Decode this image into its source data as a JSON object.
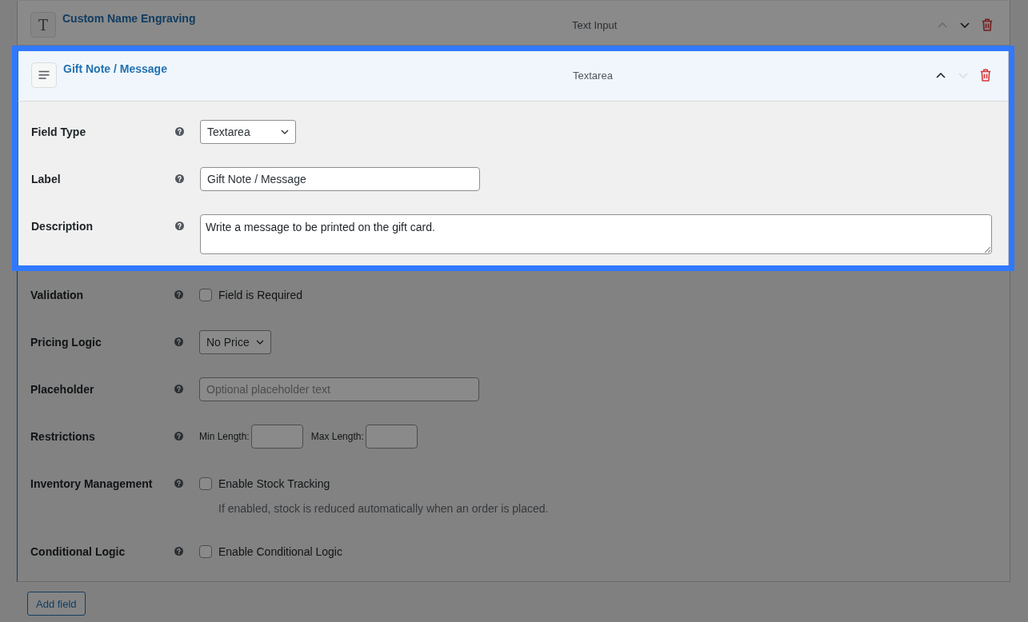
{
  "fields": [
    {
      "kind": "text",
      "icon_glyph": "T",
      "title": "Custom Name Engraving",
      "type_label": "Text Input",
      "expanded": false,
      "highlighted": false,
      "up_disabled": true,
      "down_disabled": false
    },
    {
      "kind": "textarea",
      "title": "Gift Note / Message",
      "type_label": "Textarea",
      "expanded": true,
      "highlighted": true,
      "up_disabled": false,
      "down_disabled": true,
      "settings": [
        {
          "kind": "select",
          "label": "Field Type",
          "value": "Textarea",
          "highlighted": true
        },
        {
          "kind": "text",
          "label": "Label",
          "value": "Gift Note / Message",
          "highlighted": true
        },
        {
          "kind": "textarea",
          "label": "Description",
          "value": "Write a message to be printed on the gift card.",
          "highlighted": true
        },
        {
          "kind": "checkbox",
          "label": "Validation",
          "option": "Field is Required",
          "checked": false,
          "highlighted": false
        },
        {
          "kind": "select",
          "label": "Pricing Logic",
          "value": "No Price",
          "highlighted": false
        },
        {
          "kind": "text",
          "label": "Placeholder",
          "placeholder": "Optional placeholder text",
          "highlighted": false
        },
        {
          "kind": "length_range",
          "label": "Restrictions",
          "min_label": "Min Length:",
          "max_label": "Max Length:",
          "highlighted": false
        },
        {
          "kind": "checkbox",
          "label": "Inventory Management",
          "option": "Enable Stock Tracking",
          "checked": false,
          "note": "If enabled, stock is reduced automatically when an order is placed.",
          "highlighted": false
        },
        {
          "kind": "checkbox",
          "label": "Conditional Logic",
          "option": "Enable Conditional Logic",
          "checked": false,
          "highlighted": false
        }
      ]
    }
  ],
  "add_button": {
    "label": "Add field",
    "highlighted": false
  }
}
